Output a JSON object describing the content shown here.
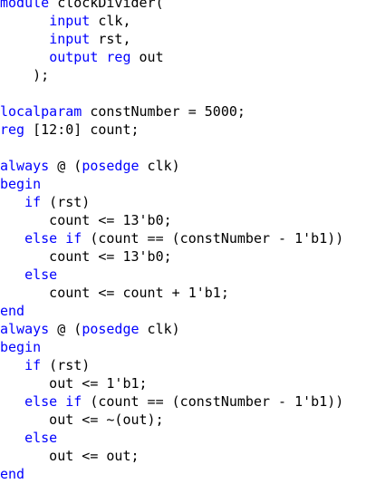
{
  "colors": {
    "keyword": "#0000ff",
    "text": "#000000",
    "background": "#ffffff"
  },
  "lines": [
    [
      {
        "t": "module",
        "k": true
      },
      {
        "t": " clockDivider(",
        "k": false
      }
    ],
    [
      {
        "t": "      ",
        "k": false
      },
      {
        "t": "input",
        "k": true
      },
      {
        "t": " clk,",
        "k": false
      }
    ],
    [
      {
        "t": "      ",
        "k": false
      },
      {
        "t": "input",
        "k": true
      },
      {
        "t": " rst,",
        "k": false
      }
    ],
    [
      {
        "t": "      ",
        "k": false
      },
      {
        "t": "output",
        "k": true
      },
      {
        "t": " ",
        "k": false
      },
      {
        "t": "reg",
        "k": true
      },
      {
        "t": " out",
        "k": false
      }
    ],
    [
      {
        "t": "    );",
        "k": false
      }
    ],
    [],
    [
      {
        "t": "localparam",
        "k": true
      },
      {
        "t": " constNumber = 5000;",
        "k": false
      }
    ],
    [
      {
        "t": "reg",
        "k": true
      },
      {
        "t": " [12:0] count;",
        "k": false
      }
    ],
    [],
    [
      {
        "t": "always",
        "k": true
      },
      {
        "t": " @ (",
        "k": false
      },
      {
        "t": "posedge",
        "k": true
      },
      {
        "t": " clk)",
        "k": false
      }
    ],
    [
      {
        "t": "begin",
        "k": true
      }
    ],
    [
      {
        "t": "   ",
        "k": false
      },
      {
        "t": "if",
        "k": true
      },
      {
        "t": " (rst)",
        "k": false
      }
    ],
    [
      {
        "t": "      count <= 13'b0;",
        "k": false
      }
    ],
    [
      {
        "t": "   ",
        "k": false
      },
      {
        "t": "else",
        "k": true
      },
      {
        "t": " ",
        "k": false
      },
      {
        "t": "if",
        "k": true
      },
      {
        "t": " (count == (constNumber - 1'b1))",
        "k": false
      }
    ],
    [
      {
        "t": "      count <= 13'b0;",
        "k": false
      }
    ],
    [
      {
        "t": "   ",
        "k": false
      },
      {
        "t": "else",
        "k": true
      }
    ],
    [
      {
        "t": "      count <= count + 1'b1;",
        "k": false
      }
    ],
    [
      {
        "t": "end",
        "k": true
      }
    ],
    [
      {
        "t": "always",
        "k": true
      },
      {
        "t": " @ (",
        "k": false
      },
      {
        "t": "posedge",
        "k": true
      },
      {
        "t": " clk)",
        "k": false
      }
    ],
    [
      {
        "t": "begin",
        "k": true
      }
    ],
    [
      {
        "t": "   ",
        "k": false
      },
      {
        "t": "if",
        "k": true
      },
      {
        "t": " (rst)",
        "k": false
      }
    ],
    [
      {
        "t": "      out <= 1'b1;",
        "k": false
      }
    ],
    [
      {
        "t": "   ",
        "k": false
      },
      {
        "t": "else",
        "k": true
      },
      {
        "t": " ",
        "k": false
      },
      {
        "t": "if",
        "k": true
      },
      {
        "t": " (count == (constNumber - 1'b1))",
        "k": false
      }
    ],
    [
      {
        "t": "      out <= ~(out);",
        "k": false
      }
    ],
    [
      {
        "t": "   ",
        "k": false
      },
      {
        "t": "else",
        "k": true
      }
    ],
    [
      {
        "t": "      out <= out;",
        "k": false
      }
    ],
    [
      {
        "t": "end",
        "k": true
      }
    ]
  ]
}
